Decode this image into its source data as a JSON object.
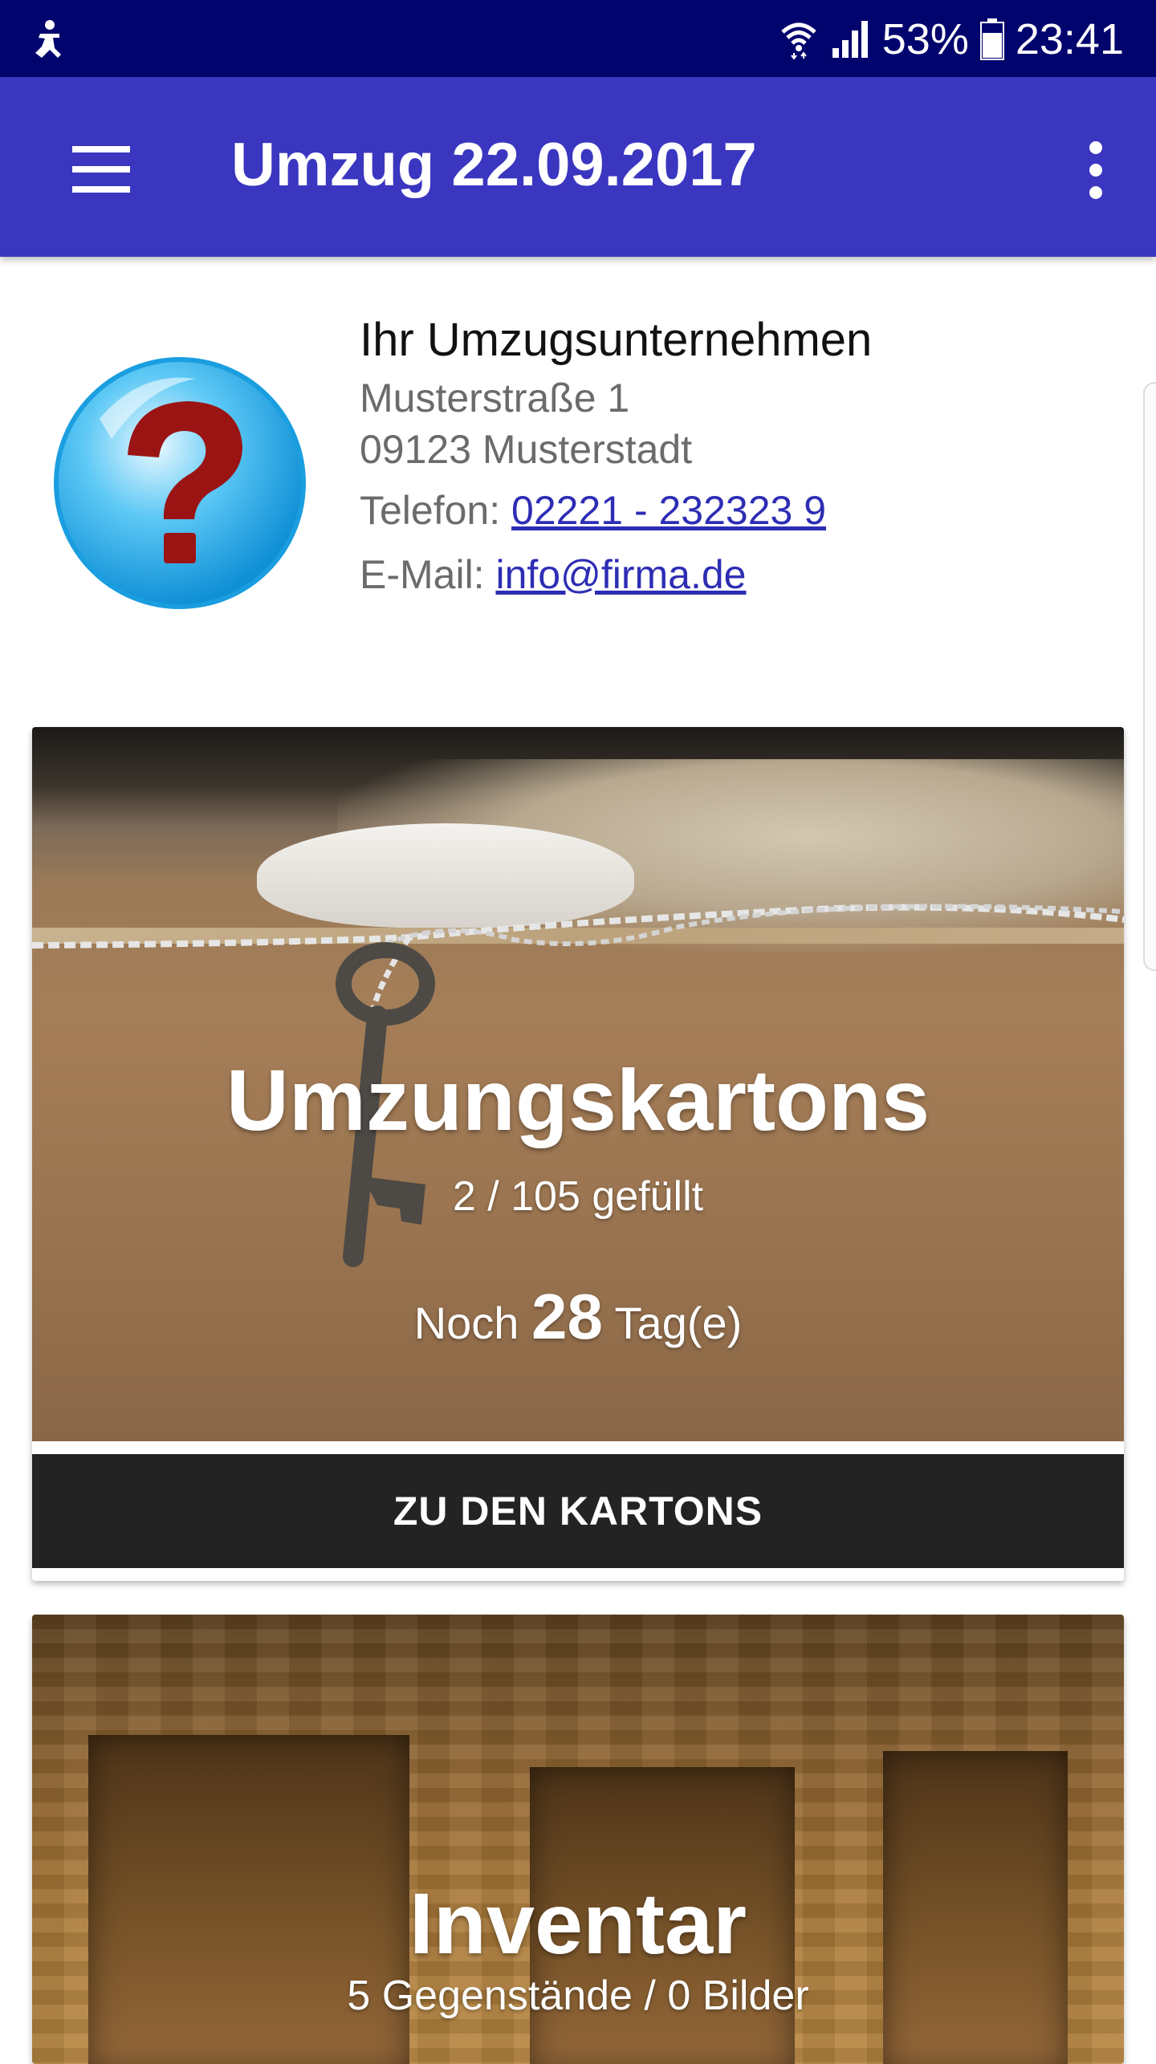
{
  "status_bar": {
    "battery": "53%",
    "time": "23:41",
    "icons": [
      "accessibility-icon",
      "wifi-icon",
      "signal-icon",
      "battery-icon"
    ]
  },
  "app_bar": {
    "title": "Umzug 22.09.2017",
    "icons": [
      "menu-icon",
      "overflow-menu-icon"
    ]
  },
  "company": {
    "name": "Ihr Umzugsunternehmen",
    "street": "Musterstraße 1",
    "city": "09123 Musterstadt",
    "phone_label": "Telefon: ",
    "phone": "02221 - 232323 9",
    "email_label": "E-Mail: ",
    "email": "info@firma.de",
    "logo_icon": "question-mark-icon"
  },
  "cards": {
    "boxes": {
      "title": "Umzungskartons",
      "progress_text": "2 / 105 gefüllt",
      "days_prefix": "Noch ",
      "days_value": "28",
      "days_suffix": " Tag(e)",
      "button_label": "ZU DEN KARTONS"
    },
    "inventory": {
      "title": "Inventar",
      "subtitle": "5 Gegenstände / 0 Bilder"
    }
  },
  "colors": {
    "status_bar": "#02046e",
    "app_bar": "#3a36c0",
    "link": "#2d2db5",
    "button": "#232323"
  }
}
